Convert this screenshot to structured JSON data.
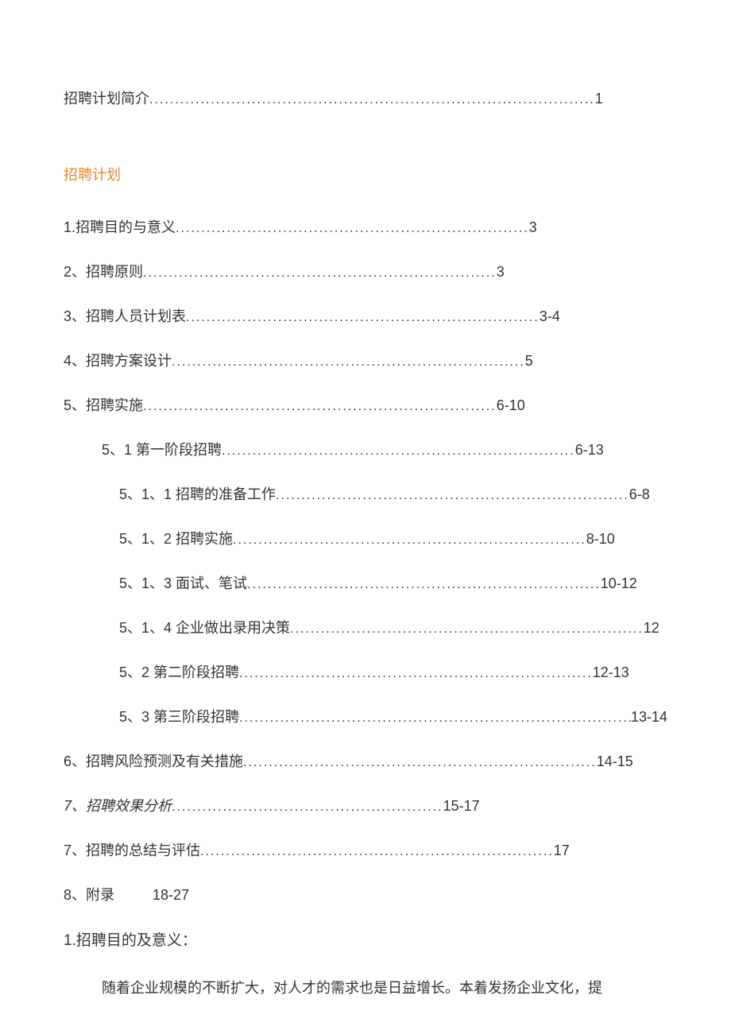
{
  "top_entry": {
    "label": "招聘计划简介",
    "page": "1"
  },
  "section_title": "招聘计划",
  "toc": [
    {
      "label": "1.招聘目的与意义 ",
      "page": "3",
      "indent": 0
    },
    {
      "label": "2、招聘原则",
      "page": "3",
      "indent": 0
    },
    {
      "label": "3、招聘人员计划表",
      "page": "3-4",
      "indent": 0
    },
    {
      "label": "4、招聘方案设计 ",
      "page": "5",
      "indent": 0
    },
    {
      "label": "5、招聘实施",
      "page": "6-10",
      "indent": 0
    },
    {
      "label": "5、1 第一阶段招聘 ",
      "page": "6-13",
      "indent": 1
    },
    {
      "label": "5、1、1 招聘的准备工作",
      "page": "6-8",
      "indent": 2
    },
    {
      "label": "5、1、2 招聘实施 ",
      "page": "8-10",
      "indent": 2
    },
    {
      "label": "5、1、3 面试、笔试 ",
      "page": "10-12",
      "indent": 2
    },
    {
      "label": "5、1、4 企业做出录用决策",
      "page": "12",
      "indent": 2
    },
    {
      "label": "5、2 第二阶段招聘",
      "page": "12-13",
      "indent": 2
    },
    {
      "label": "5、3 第三阶段招聘",
      "page": "13-14",
      "indent": 2,
      "long": true
    },
    {
      "label": "6、招聘风险预测及有关措施",
      "page": "14-15",
      "indent": 0
    },
    {
      "label": "7、招聘效果分析",
      "page": "15-17",
      "indent": 0,
      "italicnum": true,
      "short": true
    },
    {
      "label": "7、招聘的总结与评估",
      "page": "17",
      "indent": 0
    },
    {
      "label": "8、附录",
      "page": "18-27",
      "indent": 0,
      "nodots": true
    }
  ],
  "body_heading": "1.招聘目的及意义：",
  "body_para": "随着企业规模的不断扩大，对人才的需求也是日益增长。本着发扬企业文化，提"
}
